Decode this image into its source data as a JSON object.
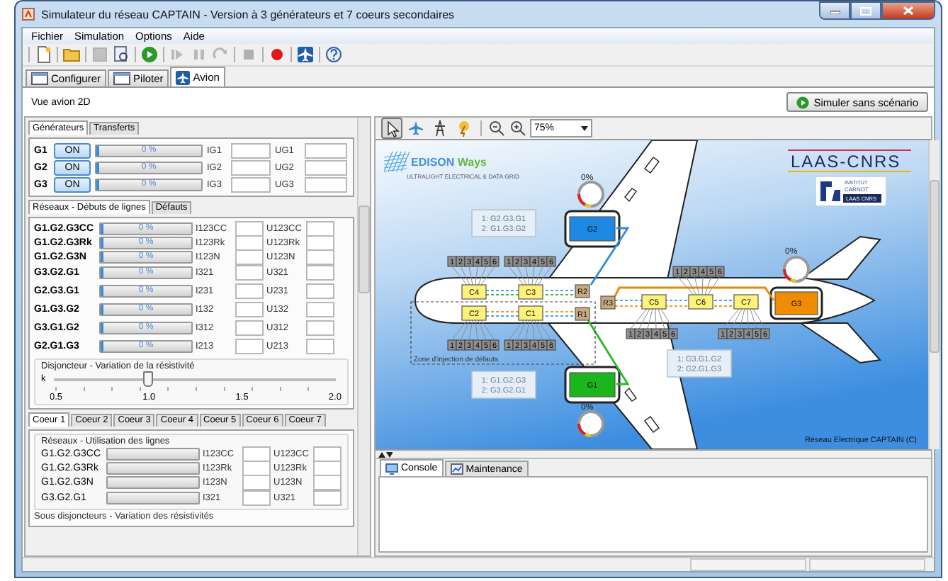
{
  "window": {
    "title": "Simulateur du réseau CAPTAIN - Version à 3 générateurs et 7 coeurs secondaires"
  },
  "menu": [
    {
      "label": "Fichier"
    },
    {
      "label": "Simulation"
    },
    {
      "label": "Options"
    },
    {
      "label": "Aide"
    }
  ],
  "toolbar": [
    {
      "kind": "new",
      "disabled": false
    },
    {
      "kind": "open",
      "disabled": false
    },
    {
      "kind": "save",
      "disabled": true
    },
    {
      "kind": "save_as",
      "disabled": false
    },
    {
      "kind": "run",
      "disabled": false
    },
    {
      "kind": "step",
      "disabled": true
    },
    {
      "kind": "pause",
      "disabled": true
    },
    {
      "kind": "redo",
      "disabled": true
    },
    {
      "kind": "stop",
      "disabled": true
    },
    {
      "kind": "record",
      "disabled": false
    },
    {
      "kind": "plane",
      "disabled": false
    },
    {
      "kind": "help",
      "disabled": false
    }
  ],
  "main_tabs": [
    {
      "label": "Configurer",
      "selected": false
    },
    {
      "label": "Piloter",
      "selected": false
    },
    {
      "label": "Avion",
      "selected": true
    }
  ],
  "view_label": "Vue avion 2D",
  "simulate_button": "Simuler sans scénario",
  "generator_tabs": [
    {
      "label": "Générateurs",
      "selected": true
    },
    {
      "label": "Transferts",
      "selected": false
    }
  ],
  "generators": [
    {
      "name": "G1",
      "button": "ON",
      "level": 0,
      "reading": "0 %",
      "current_label": "IG1",
      "voltage_label": "UG1"
    },
    {
      "name": "G2",
      "button": "ON",
      "level": 0,
      "reading": "0 %",
      "current_label": "IG2",
      "voltage_label": "UG2"
    },
    {
      "name": "G3",
      "button": "ON",
      "level": 0,
      "reading": "0 %",
      "current_label": "IG3",
      "voltage_label": "UG3"
    }
  ],
  "line_tabs": [
    {
      "label": "Réseaux - Débuts de lignes",
      "selected": true
    },
    {
      "label": "Défauts",
      "selected": false
    }
  ],
  "lines": [
    {
      "name": "G1.G2.G3CC",
      "level": 0,
      "reading": "0 %",
      "current_label": "I123CC",
      "voltage_label": "U123CC"
    },
    {
      "name": "G1.G2.G3Rk",
      "level": 0,
      "reading": "0 %",
      "current_label": "I123Rk",
      "voltage_label": "U123Rk"
    },
    {
      "name": "G1.G2.G3N",
      "level": 0,
      "reading": "0 %",
      "current_label": "I123N",
      "voltage_label": "U123N"
    },
    {
      "name": "G3.G2.G1",
      "level": 0,
      "reading": "0 %",
      "current_label": "I321",
      "voltage_label": "U321"
    },
    {
      "name": "G2.G3.G1",
      "level": 0,
      "reading": "0 %",
      "current_label": "I231",
      "voltage_label": "U231"
    },
    {
      "name": "G1.G3.G2",
      "level": 0,
      "reading": "0 %",
      "current_label": "I132",
      "voltage_label": "U132"
    },
    {
      "name": "G3.G1.G2",
      "level": 0,
      "reading": "0 %",
      "current_label": "I312",
      "voltage_label": "U312"
    },
    {
      "name": "G2.G1.G3",
      "level": 0,
      "reading": "0 %",
      "current_label": "I213",
      "voltage_label": "U213"
    }
  ],
  "breaker": {
    "title": "Disjoncteur - Variation de la résistivité",
    "label": "k",
    "level": 0.333,
    "ticks": [
      "0.5",
      "1.0",
      "1.5",
      "2.0"
    ]
  },
  "core_tabs": [
    {
      "label": "Coeur 1",
      "selected": true
    },
    {
      "label": "Coeur 2",
      "selected": false
    },
    {
      "label": "Coeur 3",
      "selected": false
    },
    {
      "label": "Coeur 4",
      "selected": false
    },
    {
      "label": "Coeur 5",
      "selected": false
    },
    {
      "label": "Coeur 6",
      "selected": false
    },
    {
      "label": "Coeur 7",
      "selected": false
    }
  ],
  "core_usage": {
    "title": "Réseaux - Utilisation des lignes",
    "lines": [
      {
        "name": "G1.G2.G3CC",
        "level": 0,
        "current_label": "I123CC",
        "voltage_label": "U123CC"
      },
      {
        "name": "G1.G2.G3Rk",
        "level": 0,
        "current_label": "I123Rk",
        "voltage_label": "U123Rk"
      },
      {
        "name": "G1.G2.G3N",
        "level": 0,
        "current_label": "I123N",
        "voltage_label": "U123N"
      },
      {
        "name": "G3.G2.G1",
        "level": 0,
        "current_label": "I321",
        "voltage_label": "U321"
      }
    ]
  },
  "core_breakers_title": "Sous disjoncteurs - Variation des résistivités",
  "diagram_toolbar": {
    "tools": [
      {
        "kind": "pointer",
        "selected": true
      },
      {
        "kind": "plane",
        "selected": false
      },
      {
        "kind": "pylon",
        "selected": false
      },
      {
        "kind": "lightning",
        "selected": false
      }
    ],
    "zoom": "75%"
  },
  "diagram": {
    "logos": {
      "edison": {
        "name": "EDISON",
        "suffix": "Ways",
        "tagline": "ULTRALIGHT ELECTRICAL & DATA GRID"
      },
      "laas": "LAAS-CNRS",
      "carnot": [
        "INSTITUT",
        "CARNOT",
        "LAAS CNRS"
      ]
    },
    "generators": [
      {
        "label": "G2",
        "color": "#1e88e5",
        "gauge": "0%"
      },
      {
        "label": "G3",
        "color": "#f08c00",
        "gauge": "0%"
      },
      {
        "label": "G1",
        "color": "#1db51d",
        "gauge": "0%"
      }
    ],
    "cores": [
      "C4",
      "C3",
      "C2",
      "C1",
      "C5",
      "C6",
      "C7"
    ],
    "repeaters": [
      "R2",
      "R1",
      "R3"
    ],
    "strips": [
      [
        "1",
        "2",
        "3",
        "4",
        "5",
        "6"
      ],
      [
        "1",
        "2",
        "3",
        "4",
        "5",
        "6"
      ],
      [
        "1",
        "2",
        "3",
        "4",
        "5",
        "6"
      ],
      [
        "1",
        "2",
        "3",
        "4",
        "5",
        "6"
      ],
      [
        "1",
        "2",
        "3",
        "4",
        "5",
        "6"
      ],
      [
        "1",
        "2",
        "3",
        "4",
        "5",
        "6"
      ],
      [
        "1",
        "2",
        "3",
        "4",
        "5",
        "6"
      ]
    ],
    "routes": [
      [
        "1: G2.G3.G1",
        "2: G1.G3.G2"
      ],
      [
        "1: G3.G1.G2",
        "2: G2.G1.G3"
      ],
      [
        "1: G1.G2.G3",
        "2: G3.G2.G1"
      ]
    ],
    "zone_label": "Zone d'injection de défauts",
    "caption": "Réseau Electrique CAPTAIN (C)"
  },
  "bottom_tabs": [
    {
      "label": "Console",
      "selected": true
    },
    {
      "label": "Maintenance",
      "selected": false
    }
  ]
}
